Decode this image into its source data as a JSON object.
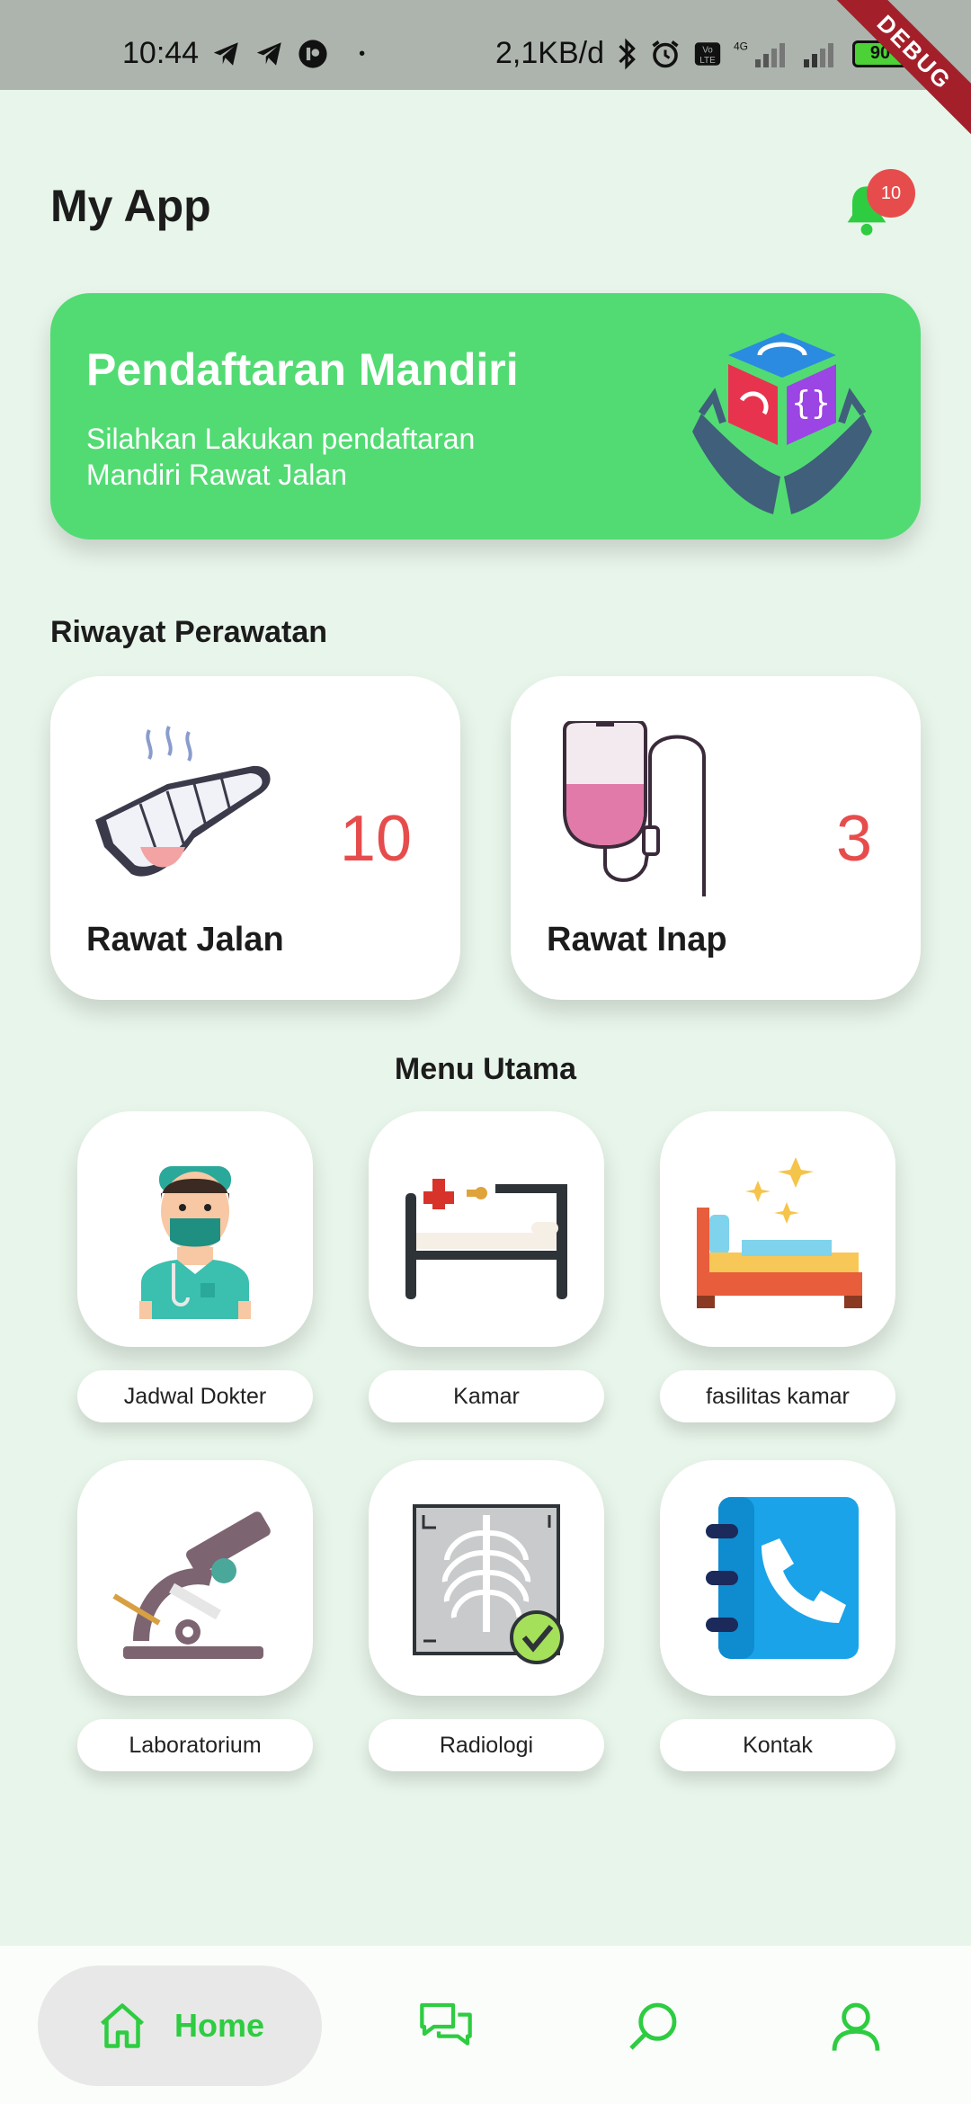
{
  "status_bar": {
    "time": "10:44",
    "network_speed": "2,1KB/d",
    "battery": "90",
    "debug_label": "DEBUG"
  },
  "header": {
    "title": "My App",
    "notification_count": "10"
  },
  "banner": {
    "title": "Pendaftaran Mandiri",
    "subtitle": "Silahkan Lakukan pendaftaran Mandiri Rawat Jalan"
  },
  "riwayat": {
    "label": "Riwayat Perawatan",
    "cards": [
      {
        "label": "Rawat Jalan",
        "value": "10"
      },
      {
        "label": "Rawat Inap",
        "value": "3"
      }
    ]
  },
  "menu": {
    "label": "Menu Utama",
    "items": [
      {
        "label": "Jadwal Dokter",
        "icon": "doctor-icon"
      },
      {
        "label": "Kamar",
        "icon": "hospital-bed-icon"
      },
      {
        "label": "fasilitas kamar",
        "icon": "bed-facility-icon"
      },
      {
        "label": "Laboratorium",
        "icon": "microscope-icon"
      },
      {
        "label": "Radiologi",
        "icon": "xray-icon"
      },
      {
        "label": "Kontak",
        "icon": "phone-book-icon"
      }
    ]
  },
  "bottom_nav": {
    "home_label": "Home",
    "items": [
      "home-icon",
      "chat-icon",
      "search-icon",
      "profile-icon"
    ]
  },
  "colors": {
    "accent": "#2ecc40",
    "banner": "#52db73",
    "value_red": "#e74c4c",
    "background": "#e8f5ea"
  }
}
